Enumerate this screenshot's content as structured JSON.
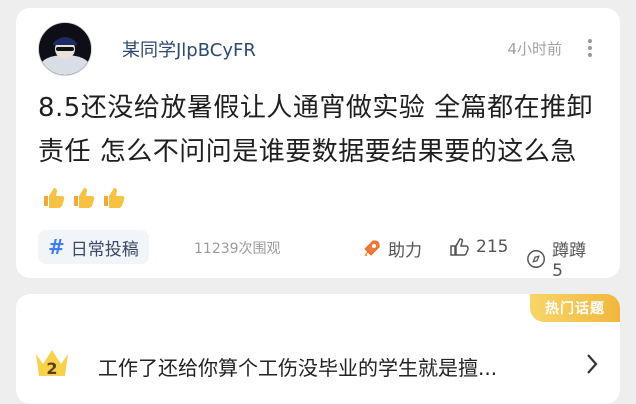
{
  "post": {
    "username": "某同学JlpBCyFR",
    "time": "4小时前",
    "content_text": "8.5还没给放暑假让人通宵做实验 全篇都在推卸责任 怎么不问问是谁要数据要结果要的这么急",
    "thumbs_icon": "thumbs-up-emoji",
    "tag_label": "日常投稿",
    "views": "11239次围观",
    "actions": {
      "boost_label": "助力",
      "like_count": "215",
      "dislike_label": "蹲蹲 5"
    }
  },
  "topic": {
    "badge": "热门话题",
    "rank": "2",
    "title": "工作了还给你算个工伤没毕业的学生就是擅..."
  },
  "colors": {
    "username": "#2c4a6e",
    "tag_hash": "#3f7bf2",
    "badge_gold": "#f2b63d"
  }
}
